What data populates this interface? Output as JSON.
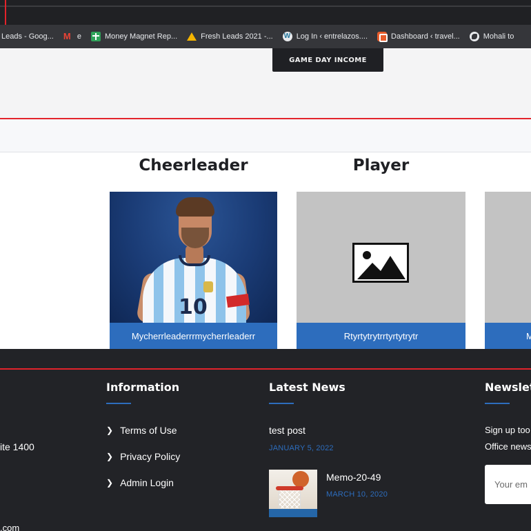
{
  "browser": {
    "bookmarks": [
      {
        "label": "Leads - Goog...",
        "icon": "none"
      },
      {
        "label": "e",
        "icon": "gmail-icon"
      },
      {
        "label": "Money Magnet Rep...",
        "icon": "money-magnet-icon"
      },
      {
        "label": "Fresh Leads 2021 -...",
        "icon": "google-drive-icon"
      },
      {
        "label": "Log In ‹ entrelazos....",
        "icon": "wordpress-icon"
      },
      {
        "label": "Dashboard ‹ travel...",
        "icon": "dashboard-icon"
      },
      {
        "label": "Mohali to",
        "icon": "globe-icon"
      }
    ]
  },
  "hero": {
    "button_label": "GAME DAY INCOME"
  },
  "cards": {
    "titles": [
      "Cheerleader",
      "Player"
    ],
    "items": [
      {
        "label": "Mycherrleaderrrmycherrleaderr",
        "image": "photo"
      },
      {
        "label": "Rtyrtytrytrrtyrtytrytr",
        "image": "placeholder"
      },
      {
        "label": "M",
        "image": "placeholder"
      }
    ]
  },
  "footer": {
    "partial_left": [
      "ite 1400",
      ".com"
    ],
    "information": {
      "title": "Information",
      "links": [
        "Terms of Use",
        "Privacy Policy",
        "Admin Login"
      ]
    },
    "news": {
      "title": "Latest News",
      "posts": [
        {
          "title": "test post",
          "date": "JANUARY 5, 2022"
        },
        {
          "title": "Memo-20-49",
          "date": "MARCH 10, 2020"
        }
      ]
    },
    "newsletter": {
      "title": "Newslet",
      "text_lines": [
        "Sign up too",
        "Office news"
      ],
      "email_placeholder": "Your em"
    }
  },
  "colors": {
    "accent_blue": "#2d6dbd",
    "accent_red": "#e3232b",
    "footer_bg": "#222327"
  }
}
